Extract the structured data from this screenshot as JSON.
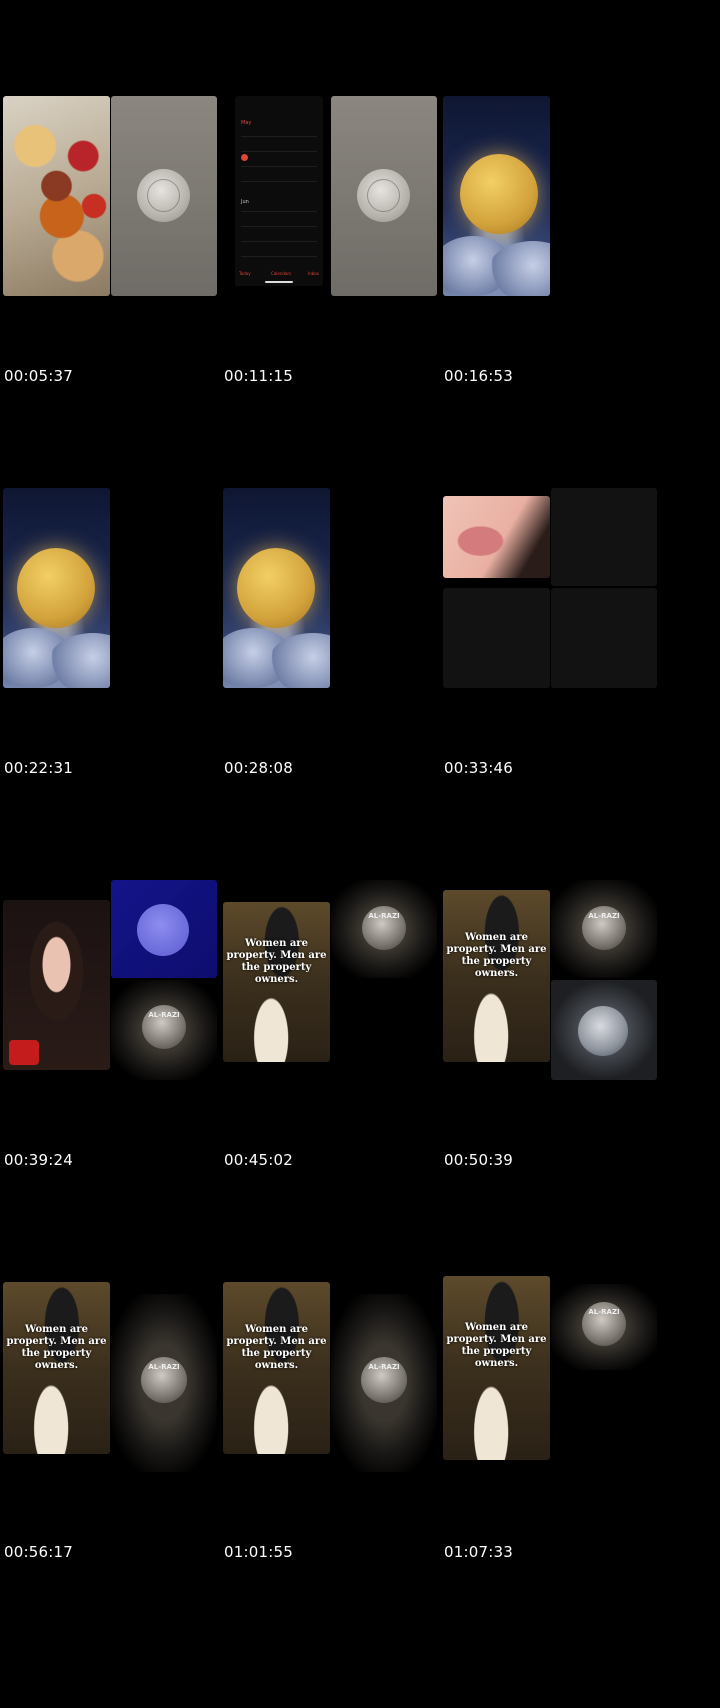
{
  "timestamps": [
    "00:05:37",
    "00:11:15",
    "00:16:53",
    "00:22:31",
    "00:28:08",
    "00:33:46",
    "00:39:24",
    "00:45:02",
    "00:50:39",
    "00:56:17",
    "01:01:55",
    "01:07:33"
  ],
  "calendar": {
    "month1": "May",
    "month2": "Jun",
    "today_label": "Today",
    "calendars_label": "Calendars",
    "inbox_label": "Inbox"
  },
  "poster_text": "Women are property. Men are the property owners.",
  "medallion_text": "AL-RAZI"
}
